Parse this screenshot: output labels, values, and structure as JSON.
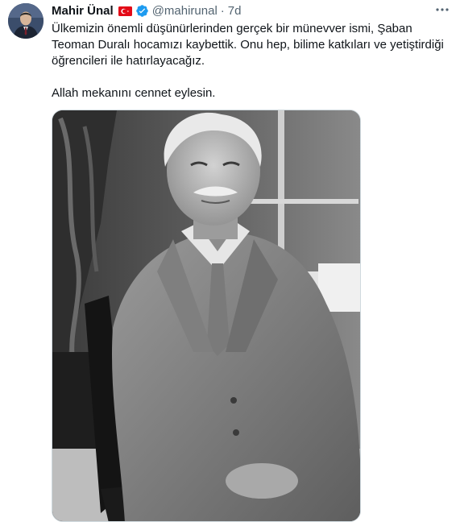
{
  "tweet": {
    "author_name": "Mahir Ünal",
    "handle": "@mahirunal",
    "separator": "·",
    "time": "7d",
    "text_paragraph_1": "Ülkemizin önemli düşünürlerinden gerçek bir münevver ismi, Şaban Teoman Duralı hocamızı kaybettik. Onu hep, bilime katkıları ve yetiştirdiği öğrencileri ile hatırlayacağız.",
    "text_paragraph_2": "Allah mekanını cennet eylesin.",
    "icons": {
      "flag": "turkey-flag-icon",
      "verified": "verified-badge-icon",
      "more": "more-options-icon"
    },
    "colors": {
      "verified": "#1d9bf0",
      "secondary_text": "#536471",
      "primary_text": "#0f1419",
      "flag_red": "#e30a17"
    }
  }
}
